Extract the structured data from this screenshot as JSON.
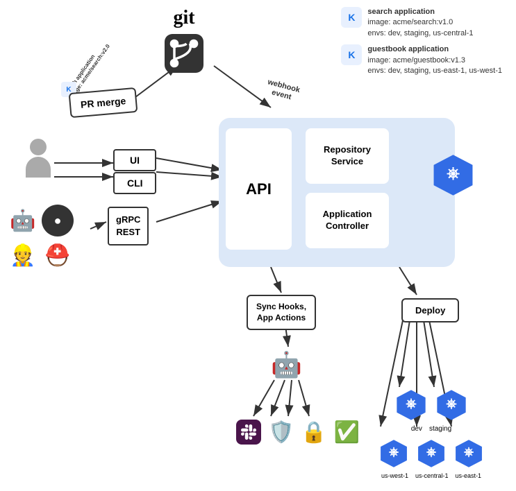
{
  "git": {
    "label": "git",
    "icon_label": "git-branch-icon"
  },
  "apps": {
    "search": {
      "name": "search application",
      "image": "image: acme/search:v1.0",
      "envs": "envs: dev, staging, us-central-1"
    },
    "guestbook": {
      "name": "guestbook application",
      "image": "image: acme/guestbook:v1.3",
      "envs": "envs: dev, staging, us-east-1, us-west-1"
    }
  },
  "pr_merge": {
    "label": "PR merge",
    "search_app_label": "search application\nimage: acme/search:v2.0"
  },
  "webhook": {
    "label": "webhook\nevent"
  },
  "user": {
    "label": "user"
  },
  "ui_box": {
    "label": "UI"
  },
  "cli_box": {
    "label": "CLI"
  },
  "grpc_box": {
    "label": "gRPC\nREST"
  },
  "api_box": {
    "label": "API"
  },
  "repo_service": {
    "label": "Repository\nService"
  },
  "app_controller": {
    "label": "Application\nController"
  },
  "sync_hooks": {
    "label": "Sync Hooks,\nApp Actions"
  },
  "deploy": {
    "label": "Deploy"
  },
  "k8s_labels": {
    "dev": "dev",
    "staging": "staging",
    "us_west": "us-west-1",
    "us_central": "us-central-1",
    "us_east": "us-east-1"
  }
}
